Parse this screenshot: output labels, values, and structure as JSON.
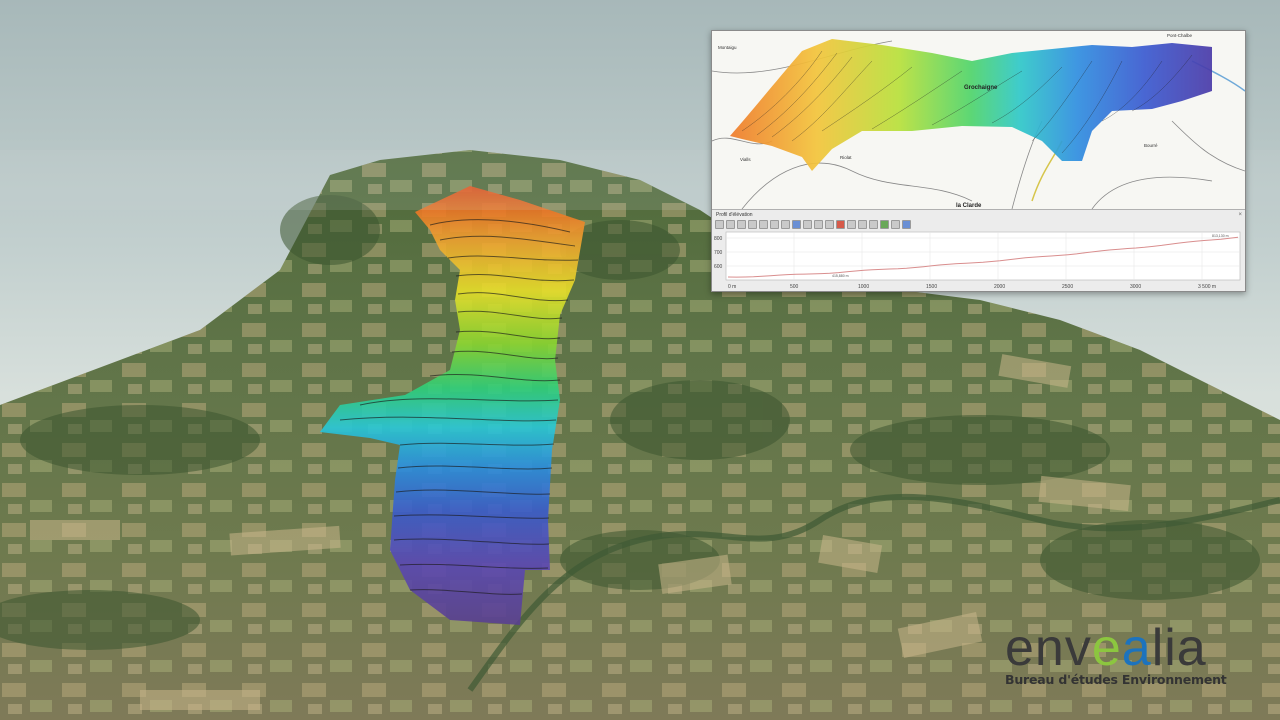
{
  "inset_map": {
    "place_labels": [
      "Montaigu",
      "Vialls",
      "Grochaigne",
      "la Clarde",
      "Pont-Chalbe",
      "Bourré",
      "Riolat"
    ]
  },
  "elevation_profile": {
    "window_title": "Profil d'élévation",
    "close_symbol": "×",
    "y_ticks": [
      "800",
      "700",
      "600"
    ],
    "x_ticks": [
      "0 m",
      "500",
      "1000",
      "1500",
      "2000",
      "2500",
      "3000",
      "3 500 m"
    ],
    "line_color": "#d98e8e",
    "start_label": "415,880 m",
    "end_label": "813,130 m"
  },
  "logo": {
    "word_part1": "env",
    "word_part_e": "e",
    "word_part_a": "a",
    "word_part2": "lia",
    "tagline": "Bureau d'études Environnement",
    "colors": {
      "green": "#8cc63f",
      "blue": "#1c73be",
      "dark": "#3a3a3a"
    }
  }
}
